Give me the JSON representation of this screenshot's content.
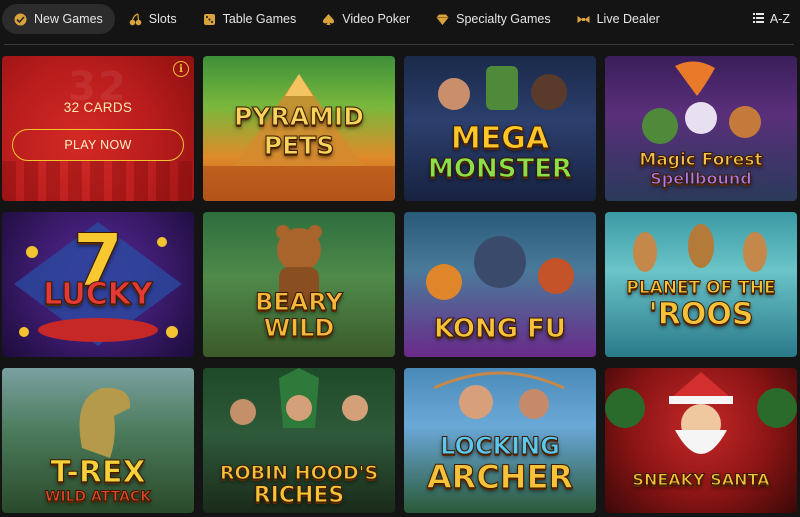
{
  "nav": {
    "items": [
      {
        "label": "New Games",
        "icon": "new-games-icon",
        "active": true
      },
      {
        "label": "Slots",
        "icon": "cherries-icon",
        "active": false
      },
      {
        "label": "Table Games",
        "icon": "dice-icon",
        "active": false
      },
      {
        "label": "Video Poker",
        "icon": "spade-icon",
        "active": false
      },
      {
        "label": "Specialty Games",
        "icon": "diamond-icon",
        "active": false
      },
      {
        "label": "Live Dealer",
        "icon": "bowtie-icon",
        "active": false
      }
    ],
    "az_label": "A-Z"
  },
  "promo": {
    "cards_label": "32 CARDS",
    "play_label": "PLAY NOW",
    "info_glyph": "i"
  },
  "games": [
    {
      "line1": "Pyramid",
      "line2": "Pets"
    },
    {
      "line1": "Mega",
      "line2": "Monster"
    },
    {
      "line1": "Magic Forest",
      "line2": "Spellbound"
    },
    {
      "line1": "Lucky",
      "line2": "7"
    },
    {
      "line1": "Beary",
      "line2": "Wild"
    },
    {
      "line1": "Kong Fu",
      "line2": ""
    },
    {
      "line1": "Planet of the",
      "line2": "'Roos"
    },
    {
      "line1": "T-Rex",
      "line2": "Wild Attack"
    },
    {
      "line1": "Robin Hood's",
      "line2": "Riches"
    },
    {
      "line1": "Locking",
      "line2": "Archer"
    },
    {
      "line1": "Sneaky Santa",
      "line2": ""
    }
  ],
  "colors": {
    "background": "#141414",
    "nav_active": "#2c2c2c",
    "promo_red": "#c62828",
    "promo_accent": "#f4c430"
  }
}
